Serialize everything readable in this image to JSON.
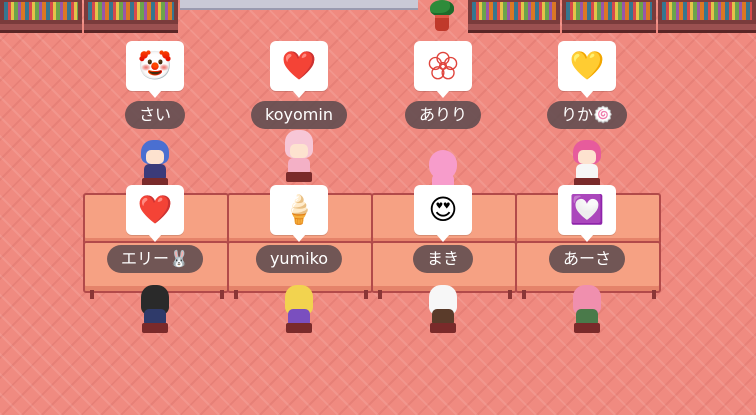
{
  "scene": {
    "background_color": "#f08a80"
  },
  "players": [
    {
      "name": "さい",
      "emote": "clown-face",
      "emote_glyph": "🤡",
      "row": "back"
    },
    {
      "name": "koyomin",
      "emote": "red-heart",
      "emote_glyph": "❤️",
      "row": "back"
    },
    {
      "name": "ありり",
      "emote": "flower-stamp",
      "emote_glyph": "",
      "row": "back"
    },
    {
      "name": "りか🍥",
      "emote": "yellow-heart",
      "emote_glyph": "💛",
      "row": "back"
    },
    {
      "name": "エリー🐰",
      "emote": "red-heart",
      "emote_glyph": "❤️",
      "row": "front"
    },
    {
      "name": "yumiko",
      "emote": "soft-ice-cream",
      "emote_glyph": "🍦",
      "row": "front"
    },
    {
      "name": "まき",
      "emote": "heart-eyes-face",
      "emote_glyph": "😍",
      "row": "front"
    },
    {
      "name": "あーさ",
      "emote": "heart-decoration",
      "emote_glyph": "💟",
      "row": "front"
    }
  ]
}
